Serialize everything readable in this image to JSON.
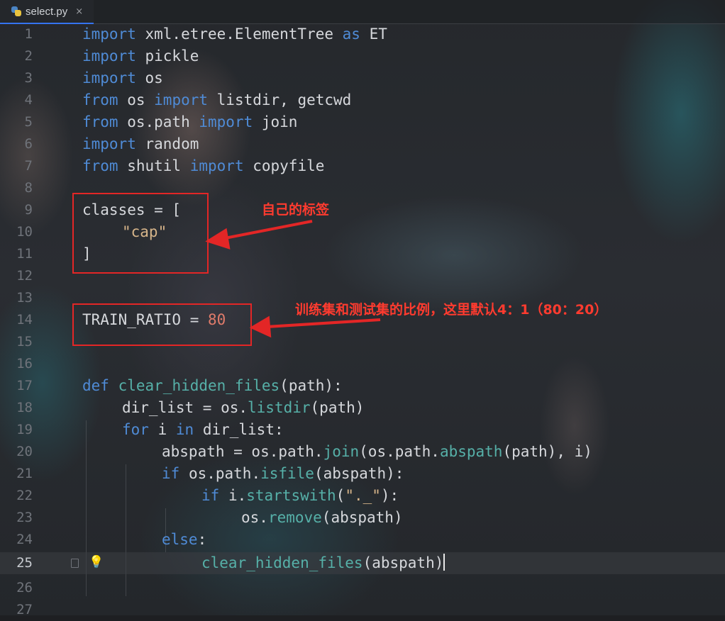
{
  "tab": {
    "filename": "select.py",
    "close": "×",
    "icon": "python-file-icon"
  },
  "lines": [
    {
      "n": "1"
    },
    {
      "n": "2"
    },
    {
      "n": "3"
    },
    {
      "n": "4"
    },
    {
      "n": "5"
    },
    {
      "n": "6"
    },
    {
      "n": "7"
    },
    {
      "n": "8"
    },
    {
      "n": "9"
    },
    {
      "n": "10"
    },
    {
      "n": "11"
    },
    {
      "n": "12"
    },
    {
      "n": "13"
    },
    {
      "n": "14"
    },
    {
      "n": "15"
    },
    {
      "n": "16"
    },
    {
      "n": "17"
    },
    {
      "n": "18"
    },
    {
      "n": "19"
    },
    {
      "n": "20"
    },
    {
      "n": "21"
    },
    {
      "n": "22"
    },
    {
      "n": "23"
    },
    {
      "n": "24"
    },
    {
      "n": "25"
    },
    {
      "n": "26"
    },
    {
      "n": "27"
    }
  ],
  "code": {
    "l1": [
      "import",
      " xml.etree.ElementTree ",
      "as",
      " ET"
    ],
    "l2": [
      "import",
      " pickle"
    ],
    "l3": [
      "import",
      " os"
    ],
    "l4": [
      "from",
      " os ",
      "import",
      " listdir, getcwd"
    ],
    "l5": [
      "from",
      " os.path ",
      "import",
      " join"
    ],
    "l6": [
      "import",
      " random"
    ],
    "l7": [
      "from",
      " shutil ",
      "import",
      " copyfile"
    ],
    "l9": "classes = [",
    "l10": "\"cap\"",
    "l11": "]",
    "l14": [
      "TRAIN_RATIO = ",
      "80"
    ],
    "l17": [
      "def",
      " ",
      "clear_hidden_files",
      "(path):"
    ],
    "l18": [
      "dir_list = os.",
      "listdir",
      "(path)"
    ],
    "l19": [
      "for",
      " i ",
      "in",
      " dir_list:"
    ],
    "l20": [
      "abspath = os.path.",
      "join",
      "(os.path.",
      "abspath",
      "(path), i)"
    ],
    "l21": [
      "if",
      " os.path.",
      "isfile",
      "(abspath):"
    ],
    "l22": [
      "if",
      " i.",
      "startswith",
      "(",
      "\"._\"",
      "):"
    ],
    "l23": [
      "os.",
      "remove",
      "(abspath)"
    ],
    "l24": [
      "else",
      ":"
    ],
    "l25": [
      "clear_hidden_files",
      "(abspath)"
    ]
  },
  "annotations": {
    "label_note": "自己的标签",
    "ratio_note": "训练集和测试集的比例，这里默认4：1（80：20）"
  },
  "colors": {
    "annotation": "#e32626",
    "keyword": "#4f8bd6",
    "function": "#56b0a8",
    "string": "#d7b58a",
    "number": "#e07b6a"
  }
}
